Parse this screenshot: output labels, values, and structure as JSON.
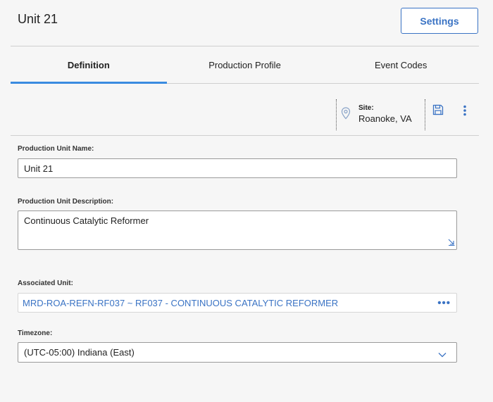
{
  "header": {
    "title": "Unit 21",
    "settings_label": "Settings"
  },
  "tabs": [
    {
      "label": "Definition",
      "active": true
    },
    {
      "label": "Production Profile",
      "active": false
    },
    {
      "label": "Event Codes",
      "active": false
    }
  ],
  "site": {
    "label": "Site:",
    "value": "Roanoke, VA",
    "icon": "map-pin-icon"
  },
  "toolbar": {
    "save_icon": "save-icon",
    "more_icon": "more-vertical-icon"
  },
  "form": {
    "name": {
      "label": "Production Unit Name:",
      "value": "Unit 21"
    },
    "description": {
      "label": "Production Unit Description:",
      "value": "Continuous Catalytic Reformer"
    },
    "associated_unit": {
      "label": "Associated Unit:",
      "value": "MRD-ROA-REFN-RF037 ~ RF037 - CONTINUOUS CATALYTIC REFORMER",
      "action_label": "•••"
    },
    "timezone": {
      "label": "Timezone:",
      "value": "(UTC-05:00) Indiana (East)"
    }
  },
  "colors": {
    "accent": "#3a73c4",
    "tab_indicator": "#3a8be0",
    "background": "#f6f6f6"
  }
}
